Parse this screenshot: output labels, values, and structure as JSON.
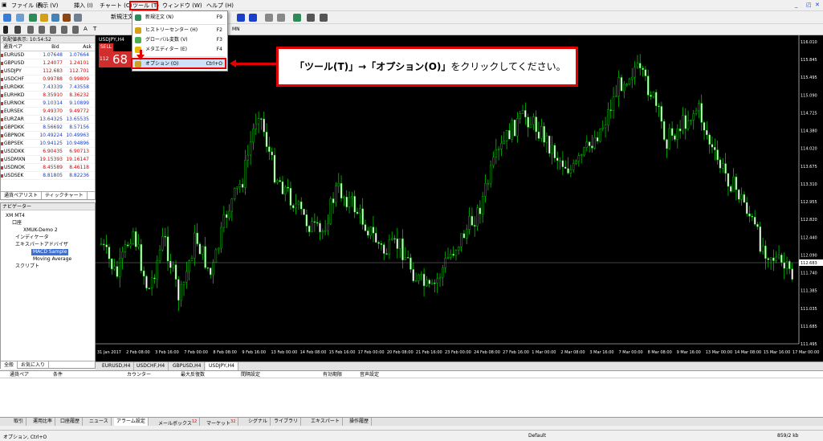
{
  "menu": [
    "ファイル (F)",
    "表示 (V)",
    "挿入 (I)",
    "チャート (C)",
    "ツール (T)",
    "ウィンドウ (W)",
    "ヘルプ (H)"
  ],
  "toolbar": {
    "new_order": "新規注文"
  },
  "timeframes": [
    "MN"
  ],
  "market_watch": {
    "title": "気配値表示: 10:54:52",
    "headers": [
      "通貨ペア",
      "Bid",
      "Ask"
    ],
    "rows": [
      {
        "sym": "EURUSD",
        "bid": "1.07648",
        "ask": "1.07664",
        "red": false
      },
      {
        "sym": "GBPUSD",
        "bid": "1.24077",
        "ask": "1.24101",
        "red": true
      },
      {
        "sym": "USDJPY",
        "bid": "112.683",
        "ask": "112.701",
        "red": true
      },
      {
        "sym": "USDCHF",
        "bid": "0.99788",
        "ask": "0.99809",
        "red": true
      },
      {
        "sym": "EURDKK",
        "bid": "7.43339",
        "ask": "7.43558",
        "red": false
      },
      {
        "sym": "EURHKD",
        "bid": "8.35910",
        "ask": "8.36232",
        "red": true
      },
      {
        "sym": "EURNOK",
        "bid": "9.10314",
        "ask": "9.10899",
        "red": false
      },
      {
        "sym": "EURSEK",
        "bid": "9.49370",
        "ask": "9.49772",
        "red": true
      },
      {
        "sym": "EURZAR",
        "bid": "13.64325",
        "ask": "13.65535",
        "red": false
      },
      {
        "sym": "GBPDKK",
        "bid": "8.56692",
        "ask": "8.57156",
        "red": false
      },
      {
        "sym": "GBPNOK",
        "bid": "10.49224",
        "ask": "10.49963",
        "red": false
      },
      {
        "sym": "GBPSEK",
        "bid": "10.94125",
        "ask": "10.94896",
        "red": false
      },
      {
        "sym": "USDDKK",
        "bid": "6.90435",
        "ask": "6.90713",
        "red": true
      },
      {
        "sym": "USDMXN",
        "bid": "19.15393",
        "ask": "19.16147",
        "red": true
      },
      {
        "sym": "USDNOK",
        "bid": "8.45589",
        "ask": "8.46118",
        "red": true
      },
      {
        "sym": "USDSEK",
        "bid": "8.81805",
        "ask": "8.82236",
        "red": false
      }
    ],
    "tabs": [
      "通貨ペアリスト",
      "ティックチャート"
    ]
  },
  "navigator": {
    "title": "ナビゲーター",
    "items": [
      "XM MT4",
      "口座",
      "XMUK-Demo 2",
      "インディケータ",
      "エキスパートアドバイザ",
      "MACD Sample",
      "Moving Average",
      "スクリプト"
    ],
    "tabs": [
      "全般",
      "お気に入り"
    ]
  },
  "chart": {
    "title": "USDJPY,H4",
    "sell_label": "SELL",
    "price_small": "112",
    "price_big": "68",
    "price_levels": [
      "116.010",
      "115.845",
      "115.495",
      "115.090",
      "114.725",
      "114.380",
      "114.020",
      "113.675",
      "113.310",
      "112.955",
      "112.820",
      "112.440",
      "112.090",
      "111.740",
      "111.385",
      "111.035",
      "111.685",
      "111.495"
    ],
    "current_price_label": "112.683",
    "dates": [
      "31 Jan 2017",
      "2 Feb 08:00",
      "3 Feb 16:00",
      "7 Feb 00:00",
      "8 Feb 08:00",
      "9 Feb 16:00",
      "13 Feb 00:00",
      "14 Feb 08:00",
      "15 Feb 16:00",
      "17 Feb 00:00",
      "20 Feb 08:00",
      "21 Feb 16:00",
      "23 Feb 00:00",
      "24 Feb 08:00",
      "27 Feb 16:00",
      "1 Mar 00:00",
      "2 Mar 08:00",
      "3 Mar 16:00",
      "7 Mar 00:00",
      "8 Mar 08:00",
      "9 Mar 16:00",
      "13 Mar 00:00",
      "14 Mar 08:00",
      "15 Mar 16:00",
      "17 Mar 00:00"
    ],
    "candle_color": "#00c000"
  },
  "chart_tabs": [
    "EURUSD,H4",
    "USDCHF,H4",
    "GBPUSD,H4",
    "USDJPY,H4"
  ],
  "terminal": {
    "headers": [
      "通貨ペア",
      "条件",
      "カウンター",
      "最大反復数",
      "間隔設定",
      "有効期限",
      "音声設定"
    ],
    "tabs": [
      "取引",
      "運用比率",
      "口座履歴",
      "ニュース",
      "アラーム設定",
      "メールボックス",
      "マーケット",
      "シグナル",
      "ライブラリ",
      "エキスパート",
      "操作履歴"
    ],
    "badges": {
      "mailbox": "12",
      "market": "32"
    }
  },
  "status": {
    "left": "オプション, Ctrl+O",
    "center": "Default",
    "right": "859/2 kb"
  },
  "tools_menu": [
    {
      "label": "新規注文 (N)",
      "shortcut": "F9",
      "icon": "new-order-icon"
    },
    {
      "label": "ヒストリーセンター (H)",
      "shortcut": "F2",
      "icon": "history-icon"
    },
    {
      "label": "グローバル変数 (V)",
      "shortcut": "F3",
      "icon": "global-vars-icon"
    },
    {
      "label": "メタエディター (E)",
      "shortcut": "F4",
      "icon": "metaeditor-icon"
    },
    {
      "label": "オプション (O)",
      "shortcut": "Ctrl+O",
      "icon": "options-icon"
    }
  ],
  "callout": {
    "quote1": "「ツール(T)」",
    "arrow": "→",
    "quote2": "「オプション(O)」",
    "rest": "をクリックしてください。"
  },
  "colors": {
    "accent": "#e30000",
    "bid_ask": "#1a3fc8",
    "down": "#d40000"
  }
}
